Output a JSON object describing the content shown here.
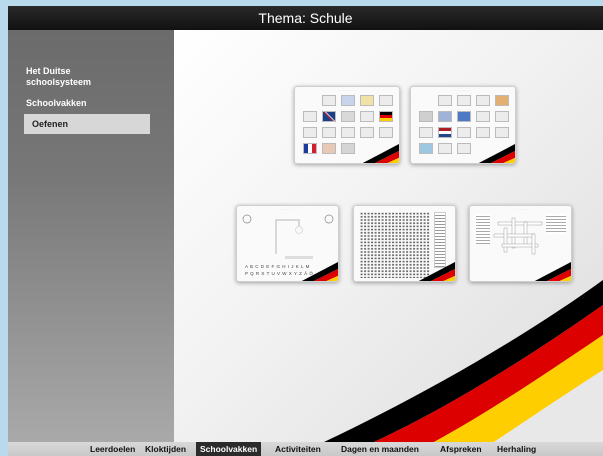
{
  "header": {
    "title": "Thema: Schule"
  },
  "sidebar": {
    "items": [
      {
        "label": "Het Duitse schoolsysteem"
      },
      {
        "label": "Schoolvakken"
      },
      {
        "label": "Oefenen"
      }
    ]
  },
  "bottom_nav": {
    "tabs": [
      {
        "label": "Leerdoelen"
      },
      {
        "label": "Kloktijden"
      },
      {
        "label": "Schoolvakken"
      },
      {
        "label": "Activiteiten"
      },
      {
        "label": "Dagen en maanden"
      },
      {
        "label": "Afspreken"
      },
      {
        "label": "Herhaling"
      }
    ],
    "active_index": 2
  },
  "exercises": [
    {
      "type": "memory"
    },
    {
      "type": "memory"
    },
    {
      "type": "hangman",
      "letters_row1": "A B C D E F G H I J K L M",
      "letters_row2": "P Q R S T U V W X Y Z Ä Ö"
    },
    {
      "type": "word-search"
    },
    {
      "type": "crossword"
    }
  ],
  "colors": {
    "flag_black": "#000000",
    "flag_red": "#dd0000",
    "flag_gold": "#ffce00",
    "active_tab_bg": "#2b2b2b"
  }
}
